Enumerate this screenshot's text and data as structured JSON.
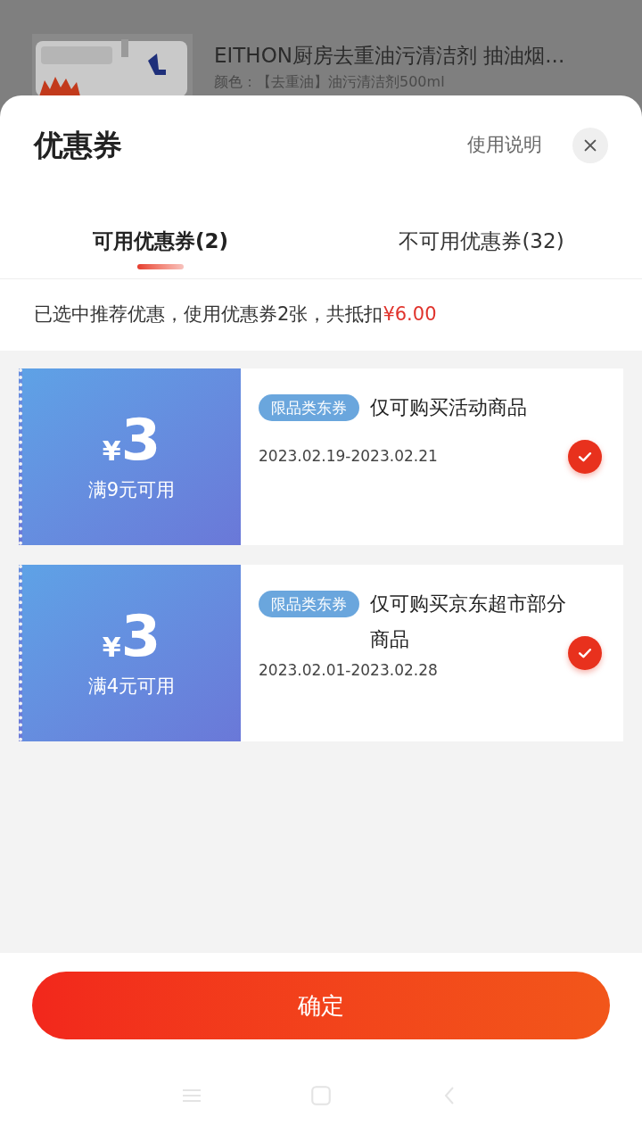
{
  "product": {
    "title": "EITHON厨房去重油污清洁剂 抽油烟...",
    "variant": "颜色：【去重油】油污清洁剂500ml"
  },
  "sheet": {
    "title": "优惠券",
    "help_link": "使用说明"
  },
  "tabs": [
    {
      "label": "可用优惠券(2)",
      "selected": true
    },
    {
      "label": "不可用优惠券(32)",
      "selected": false
    }
  ],
  "summary": {
    "text": "已选中推荐优惠，使用优惠券2张，共抵扣",
    "amount": "¥6.00"
  },
  "coupons": [
    {
      "currency": "¥",
      "amount": "3",
      "condition": "满9元可用",
      "tag": "限品类东券",
      "description": "仅可购买活动商品",
      "validity": "2023.02.19-2023.02.21",
      "selected": true
    },
    {
      "currency": "¥",
      "amount": "3",
      "condition": "满4元可用",
      "tag": "限品类东券",
      "description": "仅可购买京东超市部分商品",
      "validity": "2023.02.01-2023.02.28",
      "selected": true
    }
  ],
  "confirm_button": "确定"
}
